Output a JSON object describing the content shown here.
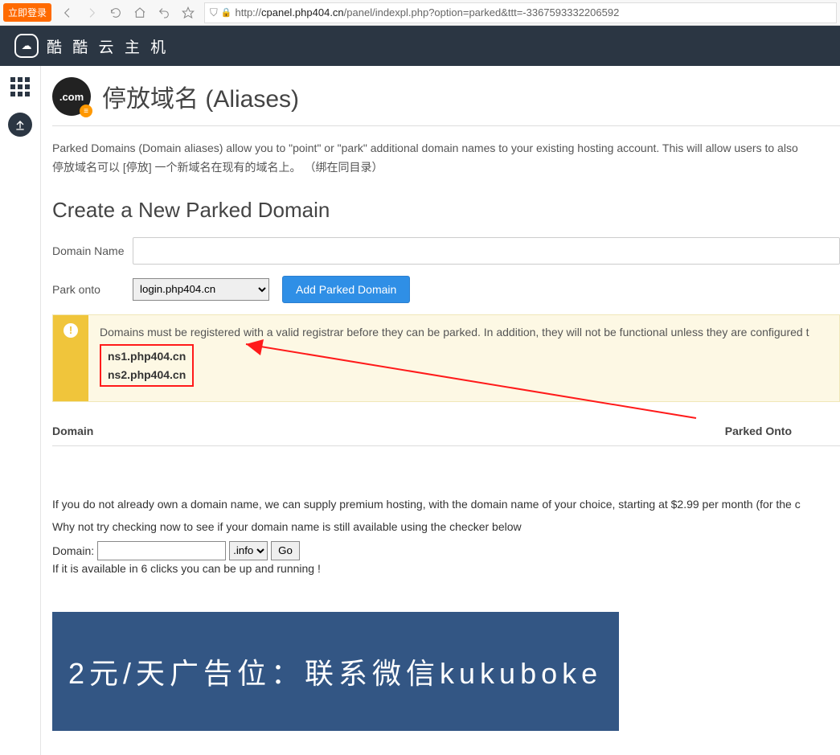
{
  "browser": {
    "login_badge": "立即登录",
    "url_prefix": "http://",
    "url_host": "cpanel.php404.cn",
    "url_path": "/panel/indexpl.php?option=parked&ttt=-3367593332206592"
  },
  "header": {
    "brand": "酷 酷 云 主 机"
  },
  "page": {
    "icon_label": ".com",
    "title": "停放域名 (Aliases)",
    "desc_en": "Parked Domains (Domain aliases) allow you to \"point\" or \"park\" additional domain names to your existing hosting account. This will allow users to also",
    "desc_cn": "停放域名可以 [停放] 一个新域名在现有的域名上。 （绑在同目录）",
    "section_create": "Create a New Parked Domain",
    "label_domain_name": "Domain Name",
    "label_park_onto": "Park onto",
    "select_options": [
      "login.php404.cn"
    ],
    "add_button": "Add Parked Domain",
    "warning_text": "Domains must be registered with a valid registrar before they can be parked. In addition, they will not be functional unless they are configured t",
    "ns1": "ns1.php404.cn",
    "ns2": "ns2.php404.cn",
    "table": {
      "col_domain": "Domain",
      "col_parked": "Parked Onto"
    },
    "supply_text": "If you do not already own a domain name, we can supply premium hosting, with the domain name of your choice, starting at $2.99 per month (for the c",
    "checker_text": "Why not try checking now to see if your domain name is still available using the checker below",
    "checker_label": "Domain:",
    "tld_options": [
      ".info"
    ],
    "go_button": "Go",
    "avail_text": "If it is available in 6 clicks you can be up and running !",
    "ad_text": "2元/天广告位：联系微信kukuboke"
  }
}
